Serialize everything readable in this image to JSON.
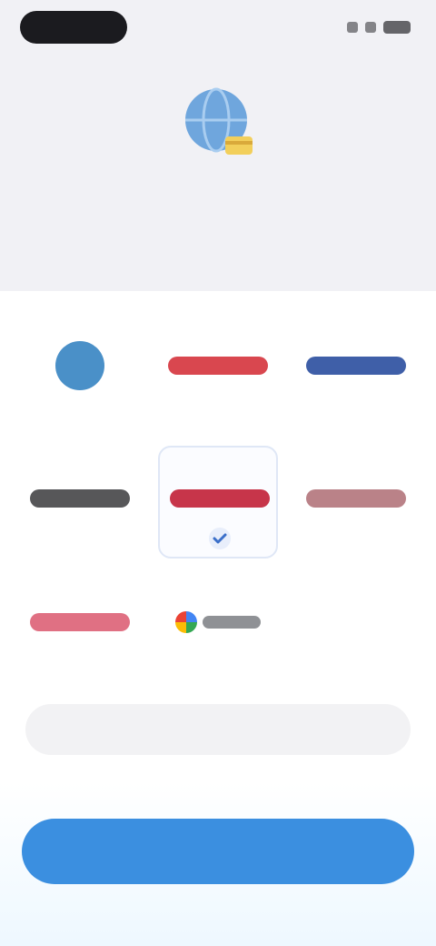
{
  "status_bar": {
    "time": ""
  },
  "header": {
    "icon": "globe-card-icon",
    "title_line1": "",
    "title_line2": ""
  },
  "payment_options": [
    {
      "id": "option-1",
      "logo": "round-blue-logo",
      "logo_color": "#4a90c8",
      "caption": "",
      "selected": false
    },
    {
      "id": "option-2",
      "logo": "bar-logo",
      "logo_color": "#d9474f",
      "caption": "",
      "selected": false
    },
    {
      "id": "option-3",
      "logo": "bar-logo",
      "logo_color": "#3f5fa8",
      "caption": "",
      "selected": false
    },
    {
      "id": "option-4",
      "logo": "bar-logo",
      "logo_color": "#3a3a3c",
      "caption": "",
      "selected": false
    },
    {
      "id": "option-5",
      "logo": "bar-logo",
      "logo_color": "#c7354a",
      "caption": "",
      "selected": true
    },
    {
      "id": "option-6",
      "logo": "bar-logo",
      "logo_color": "#8c2f39",
      "caption": "",
      "selected": false
    },
    {
      "id": "option-7",
      "logo": "bar-logo",
      "logo_color": "#d6405a",
      "caption": "",
      "selected": false
    },
    {
      "id": "option-8",
      "logo": "google-pay-logo",
      "logo_color": "#34a853",
      "caption": "",
      "selected": false
    }
  ],
  "buttons": {
    "secondary_label": "",
    "primary_label": ""
  },
  "colors": {
    "accent": "#3b8fe0",
    "secondary_text": "#3d7ede",
    "background_top": "#f1f1f5"
  }
}
